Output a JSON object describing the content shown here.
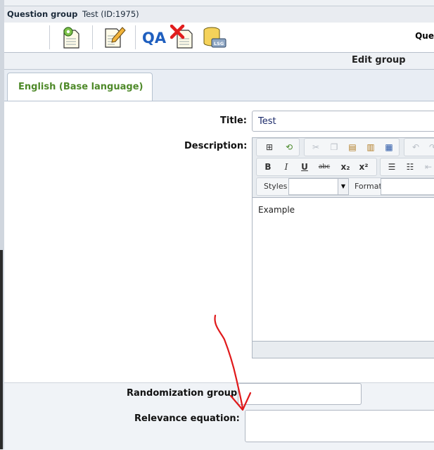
{
  "header": {
    "label": "Question group",
    "value": "Test (ID:1975)"
  },
  "toolbar": {
    "icons": [
      "gear-document-icon",
      "edit-document-icon",
      "qa-icon",
      "delete-document-icon",
      "lsg-export-icon"
    ],
    "right_text": "Que"
  },
  "section_title": "Edit group",
  "tabs": [
    {
      "label": "English (Base language)"
    }
  ],
  "form": {
    "title_label": "Title:",
    "title_value": "Test",
    "description_label": "Description:",
    "description_text": "Example",
    "styles_label": "Styles",
    "format_label": "Format",
    "randomization_label": "Randomization group:",
    "randomization_value": "",
    "relevance_label": "Relevance equation:",
    "relevance_value": ""
  },
  "colors": {
    "tab_text": "#4f8a2a",
    "annotation_arrow": "#e0191b"
  }
}
